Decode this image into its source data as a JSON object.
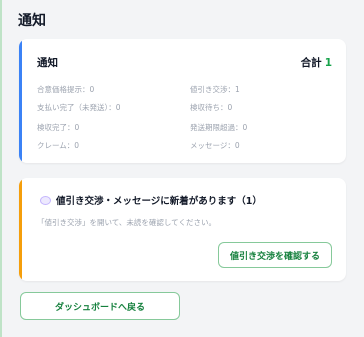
{
  "page": {
    "title": "通知"
  },
  "summary": {
    "title": "通知",
    "total_label": "合計",
    "total_value": "1",
    "stats": [
      "合意価格提示：0",
      "値引き交渉：1",
      "支払い完了（未発送）：0",
      "検収待ち：0",
      "検収完了：0",
      "発送期限超過：0",
      "クレーム：0",
      "メッセージ：0"
    ]
  },
  "alert": {
    "icon": "speech-bubble-icon",
    "heading": "値引き交渉・メッセージに新着があります（1）",
    "description": "「値引き交渉」を開いて、未読を確認してください。",
    "button_label": "値引き交渉を確認する"
  },
  "footer": {
    "back_label": "ダッシュボードへ戻る"
  },
  "colors": {
    "accent_blue": "#3b82f6",
    "accent_orange": "#f59e0b",
    "green": "#16a34a",
    "button_border": "#86c99a"
  }
}
